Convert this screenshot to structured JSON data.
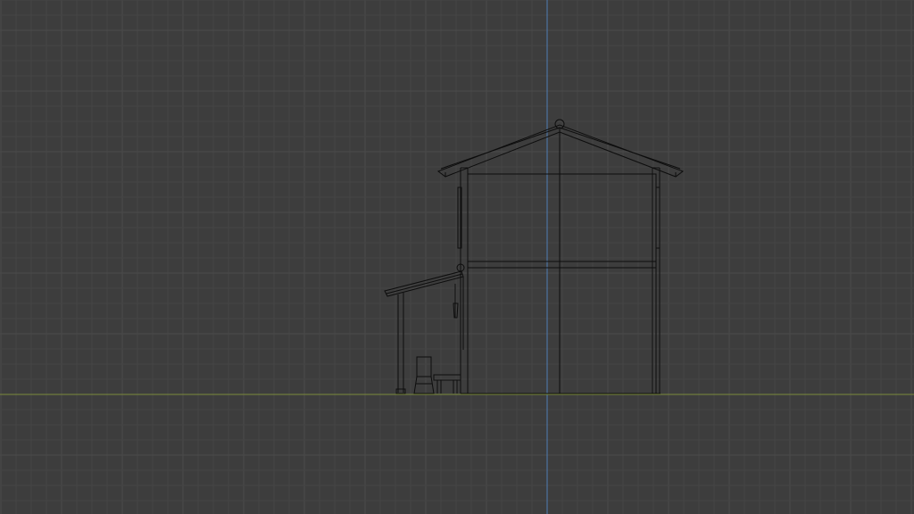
{
  "viewport": {
    "view": "orthographic-side",
    "colors": {
      "background": "#3d3d3d",
      "grid_minor": "#454545",
      "grid_major": "#4a4a4a",
      "axis_z": "#4f7db5",
      "axis_y": "#7c8a3a",
      "wire": "#0d0d0d"
    }
  },
  "model": {
    "type": "house-wireframe",
    "parts": [
      "main-building",
      "gable-roof",
      "ridge-cap",
      "floor-beam",
      "porch-roof",
      "porch-post",
      "chair",
      "stool",
      "wall-windows"
    ]
  }
}
